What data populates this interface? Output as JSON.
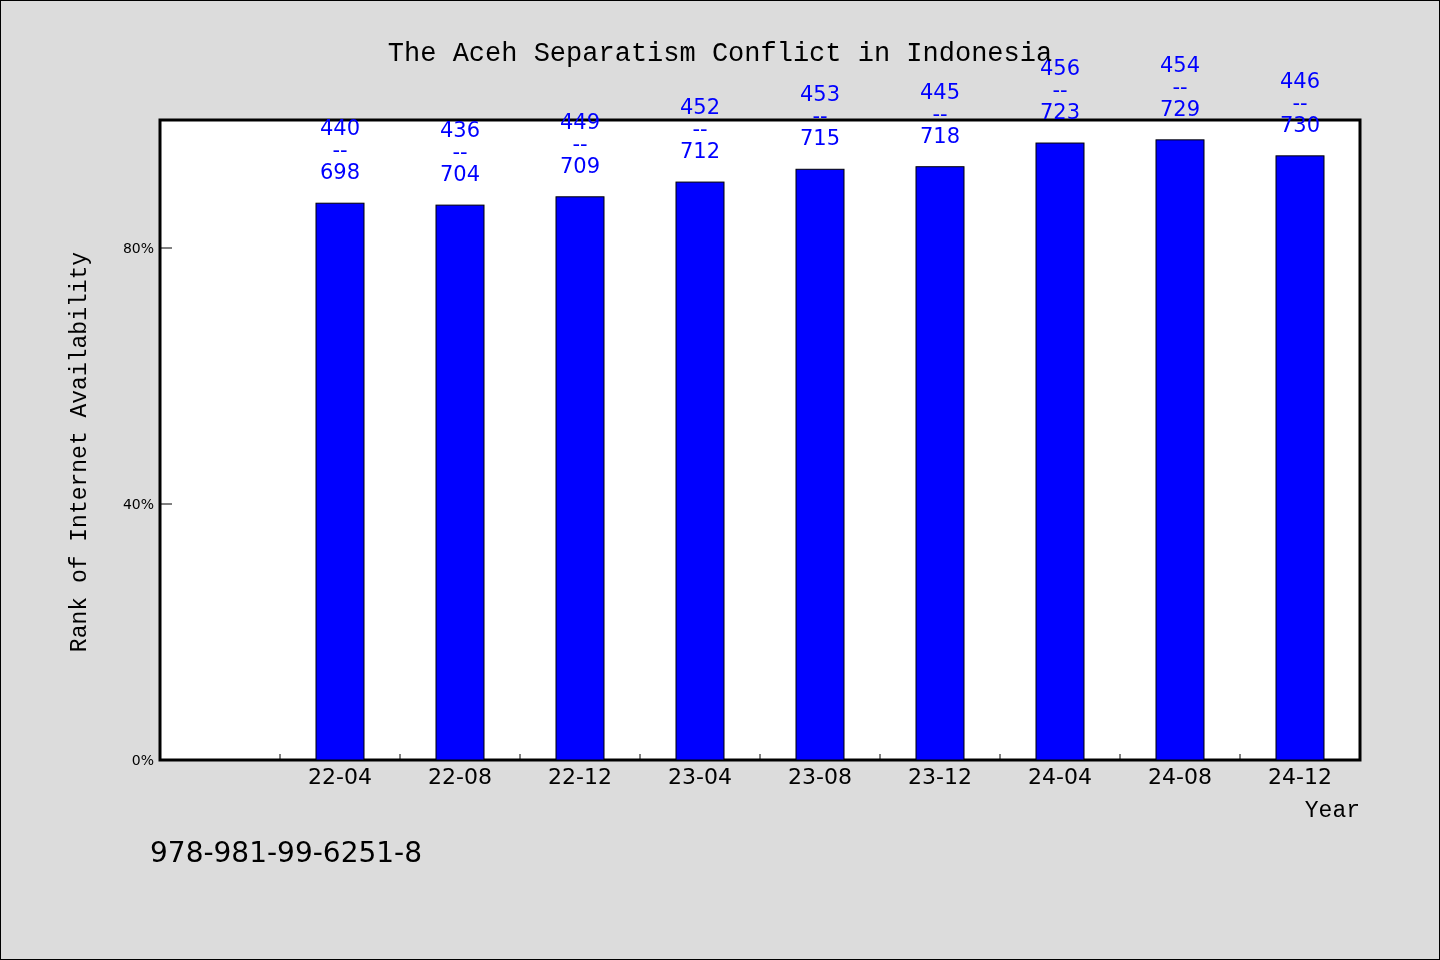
{
  "chart": {
    "chart_data": {
      "type": "bar",
      "title": "The Aceh Separatism Conflict in Indonesia",
      "xlabel": "Year",
      "ylabel": "Rank of Internet Availability",
      "categories": [
        "22-04",
        "22-08",
        "22-12",
        "23-04",
        "23-08",
        "23-12",
        "24-04",
        "24-08",
        "24-12"
      ],
      "series": [
        {
          "color": "#0000ff",
          "values": [
            87.0,
            86.7,
            88.0,
            90.3,
            92.3,
            92.7,
            96.4,
            96.9,
            94.4
          ]
        }
      ],
      "ylim": [
        0,
        100
      ],
      "yticks": [
        {
          "value": 0,
          "label": "0%"
        },
        {
          "value": 40,
          "label": "40%"
        },
        {
          "value": 80,
          "label": "80%"
        }
      ],
      "value_labels": [
        "440\n--\n698",
        "436\n--\n704",
        "449\n--\n709",
        "452\n--\n712",
        "453\n--\n715",
        "445\n--\n718",
        "456\n--\n723",
        "454\n--\n729",
        "446\n--\n730"
      ]
    }
  },
  "footer": {
    "text": "978-981-99-6251-8"
  }
}
